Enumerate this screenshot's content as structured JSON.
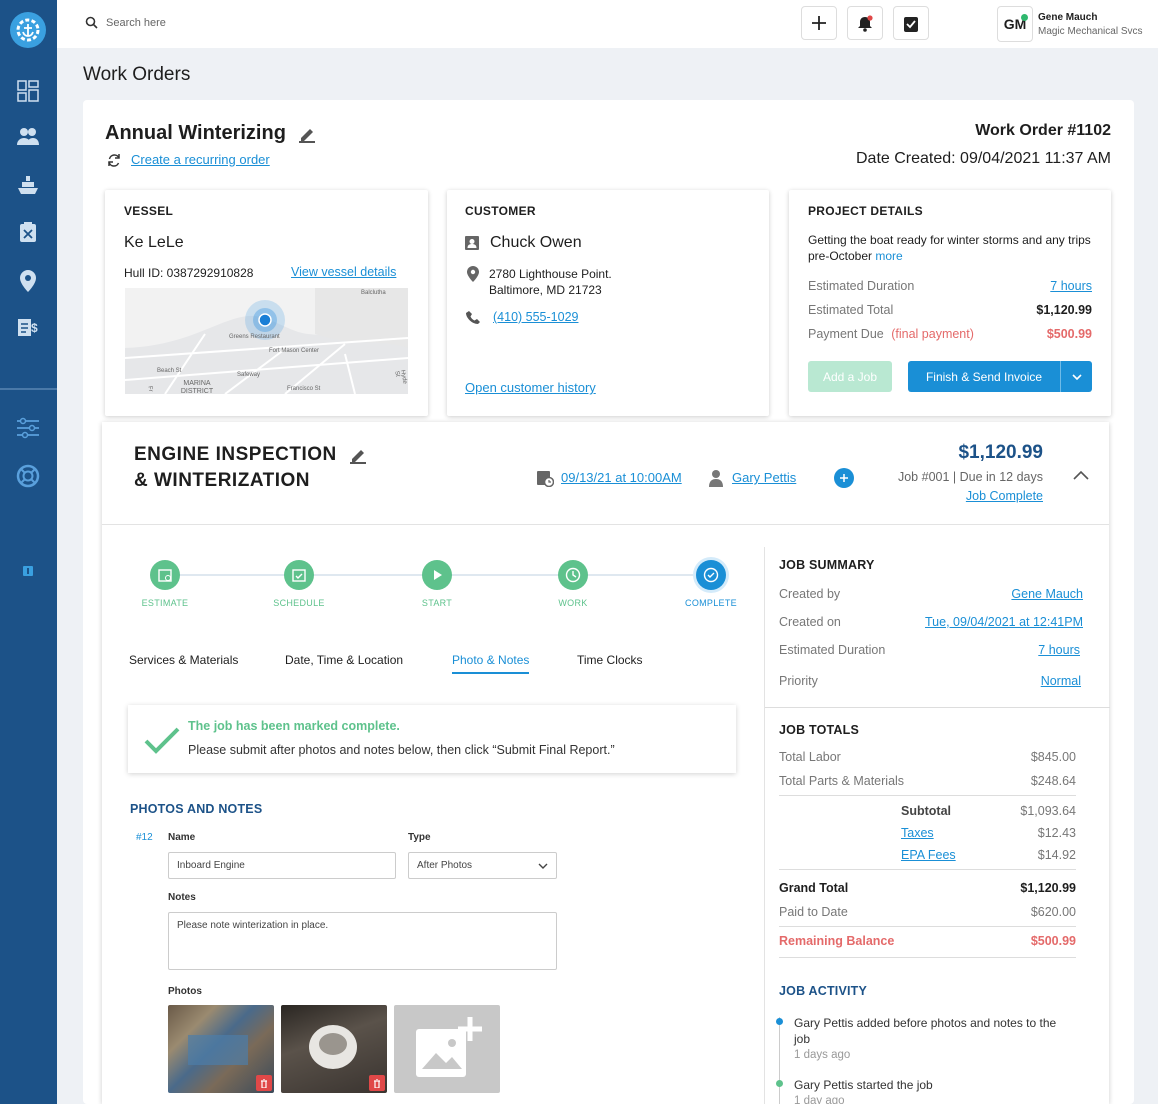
{
  "search": {
    "placeholder": "Search here"
  },
  "user": {
    "initials": "GM",
    "name": "Gene Mauch",
    "company": "Magic Mechanical Svcs"
  },
  "page": {
    "title": "Work Orders"
  },
  "work_order": {
    "title": "Annual Winterizing",
    "recurring_link": "Create a recurring order",
    "number": "Work Order #1102",
    "date_created": "Date Created: 09/04/2021 11:37 AM"
  },
  "vessel": {
    "heading": "VESSEL",
    "name": "Ke LeLe",
    "hull": "Hull ID: 0387292910828",
    "details_link": "View vessel details",
    "map_labels": [
      "Balclutha",
      "Greens Restaurant",
      "Fort Mason Center",
      "Beach St",
      "Safeway",
      "MARINA DISTRICT",
      "Francisco St",
      "Hyde St",
      "Fr"
    ]
  },
  "customer": {
    "heading": "CUSTOMER",
    "name": "Chuck Owen",
    "address1": "2780 Lighthouse Point.",
    "address2": "Baltimore, MD 21723",
    "phone": "(410) 555-1029",
    "history_link": "Open customer history"
  },
  "project": {
    "heading": "PROJECT DETAILS",
    "desc": "Getting the boat ready for winter storms and any trips pre-October",
    "more": "more",
    "duration_label": "Estimated Duration",
    "duration": "7 hours",
    "total_label": "Estimated Total",
    "total": "$1,120.99",
    "payment_label": "Payment Due",
    "payment_note": "(final payment)",
    "payment": "$500.99",
    "add_job": "Add a Job",
    "finish": "Finish & Send Invoice"
  },
  "job": {
    "title1": "ENGINE INSPECTION",
    "title2": "& WINTERIZATION",
    "date": "09/13/21 at 10:00AM",
    "tech": "Gary Pettis",
    "amount": "$1,120.99",
    "meta": "Job #001 | Due in 12 days",
    "status": "Job Complete"
  },
  "steps": [
    "ESTIMATE",
    "SCHEDULE",
    "START",
    "WORK",
    "COMPLETE"
  ],
  "tabs": [
    "Services & Materials",
    "Date, Time & Location",
    "Photo & Notes",
    "Time Clocks"
  ],
  "alert": {
    "title": "The job has been marked complete.",
    "text": "Please submit after photos and notes below, then click “Submit Final Report.”"
  },
  "photos": {
    "heading": "PHOTOS AND NOTES",
    "num": "#12",
    "name_label": "Name",
    "name_value": "Inboard Engine",
    "type_label": "Type",
    "type_value": "After Photos",
    "notes_label": "Notes",
    "notes_value": "Please note winterization in place.",
    "photos_label": "Photos"
  },
  "summary": {
    "heading": "JOB SUMMARY",
    "created_by_label": "Created by",
    "created_by": "Gene Mauch",
    "created_on_label": "Created on",
    "created_on": "Tue, 09/04/2021 at 12:41PM",
    "duration_label": "Estimated Duration",
    "duration": "7 hours",
    "priority_label": "Priority",
    "priority": "Normal"
  },
  "totals": {
    "heading": "JOB TOTALS",
    "labor_label": "Total Labor",
    "labor": "$845.00",
    "parts_label": "Total Parts & Materials",
    "parts": "$248.64",
    "subtotal_label": "Subtotal",
    "subtotal": "$1,093.64",
    "taxes_label": "Taxes",
    "taxes": "$12.43",
    "epa_label": "EPA Fees",
    "epa": "$14.92",
    "grand_label": "Grand Total",
    "grand": "$1,120.99",
    "paid_label": "Paid to Date",
    "paid": "$620.00",
    "remaining_label": "Remaining Balance",
    "remaining": "$500.99"
  },
  "activity": {
    "heading": "JOB ACTIVITY",
    "items": [
      {
        "text": "Gary Pettis added before photos and notes to the job",
        "time": "1 days ago"
      },
      {
        "text": "Gary Pettis started the job",
        "time": "1 day ago"
      }
    ]
  },
  "colors": {
    "sidebar": "#1c5288",
    "accent": "#1a8fd6",
    "green": "#5ec28c",
    "red": "#e46a6a"
  }
}
